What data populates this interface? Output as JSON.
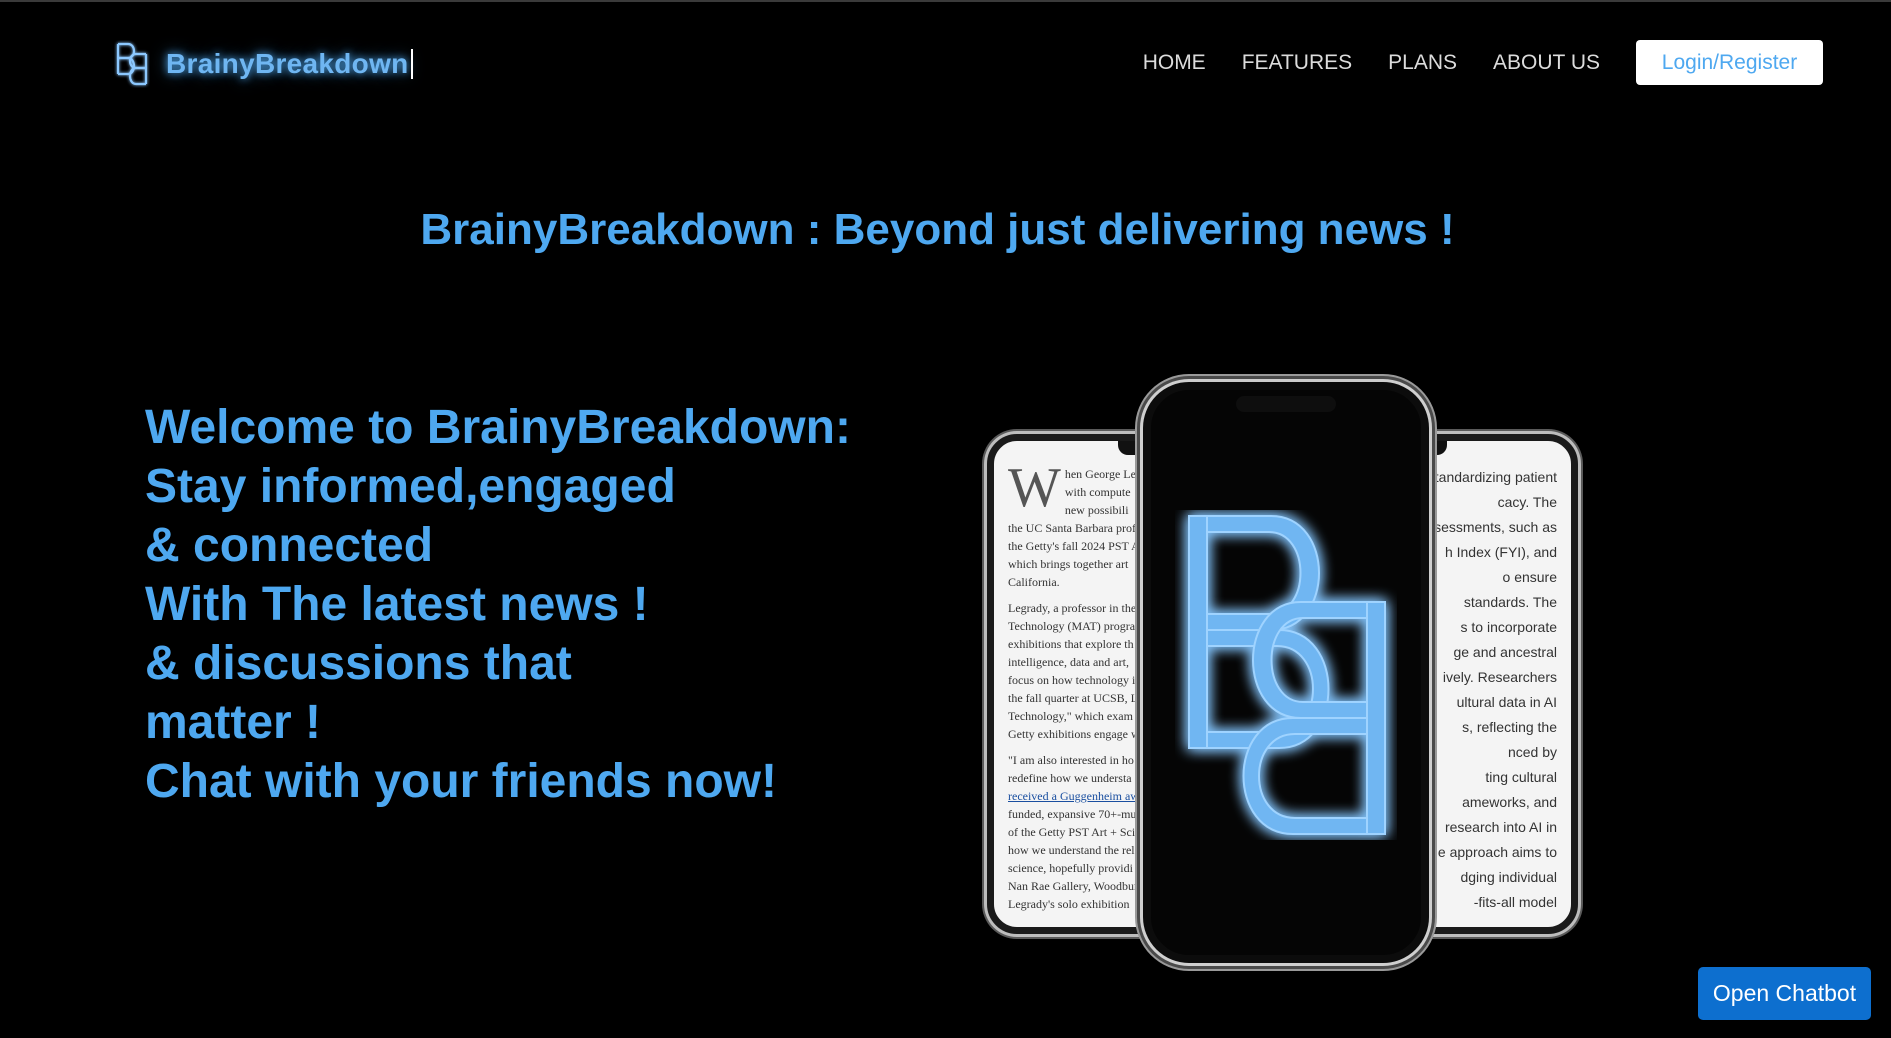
{
  "brand": {
    "name": "BrainyBreakdown",
    "logo_icon": "bb-monogram-icon",
    "accent_color": "#4ea8f0"
  },
  "nav": {
    "items": [
      {
        "label": "HOME"
      },
      {
        "label": "FEATURES"
      },
      {
        "label": "PLANS"
      },
      {
        "label": "ABOUT US"
      }
    ],
    "login_label": "Login/Register"
  },
  "hero": {
    "title": "BrainyBreakdown : Beyond just delivering news !",
    "tagline": [
      "Welcome to BrainyBreakdown:",
      "Stay informed,engaged",
      "& connected",
      "With The latest news !",
      "& discussions that",
      "matter !",
      "Chat with your friends now!"
    ]
  },
  "mockup": {
    "left_screen": {
      "dropcap": "W",
      "lines": [
        "hen George Le",
        "with compute",
        "new possibili",
        "the UC Santa Barbara prof",
        "the Getty's fall 2024 PST A",
        "which brings together art",
        "California.",
        "Legrady, a professor in the",
        "Technology (MAT) program",
        "exhibitions that explore th",
        "intelligence, data and art, ",
        "focus on how technology i",
        "the fall quarter at UCSB, Le",
        "Technology,\" which exam",
        "Getty exhibitions engage w",
        "\"I am also interested in ho",
        "redefine how we understa",
        "received a Guggenheim aw",
        "funded, expansive 70+-mu",
        "of the Getty PST Art + Scie",
        "how we understand the rel",
        "science, hopefully providi",
        "Nan Rae Gallery, Woodbur",
        "Legrady's solo exhibition"
      ],
      "link_text": "received a Guggenheim"
    },
    "right_screen": {
      "lines": [
        "standardizing patient",
        "cacy. The",
        "sessments, such as",
        "h Index (FYI), and",
        "o ensure",
        "standards. The",
        "s to incorporate",
        "ge and ancestral",
        "ively. Researchers",
        "ultural data in AI",
        "s, reflecting the",
        "nced by",
        "ting cultural",
        "ameworks, and",
        "research into AI in",
        "e approach aims to",
        "dging individual",
        "-fits-all model"
      ]
    }
  },
  "chatbot": {
    "label": "Open Chatbot",
    "color": "#0d6fcf"
  }
}
